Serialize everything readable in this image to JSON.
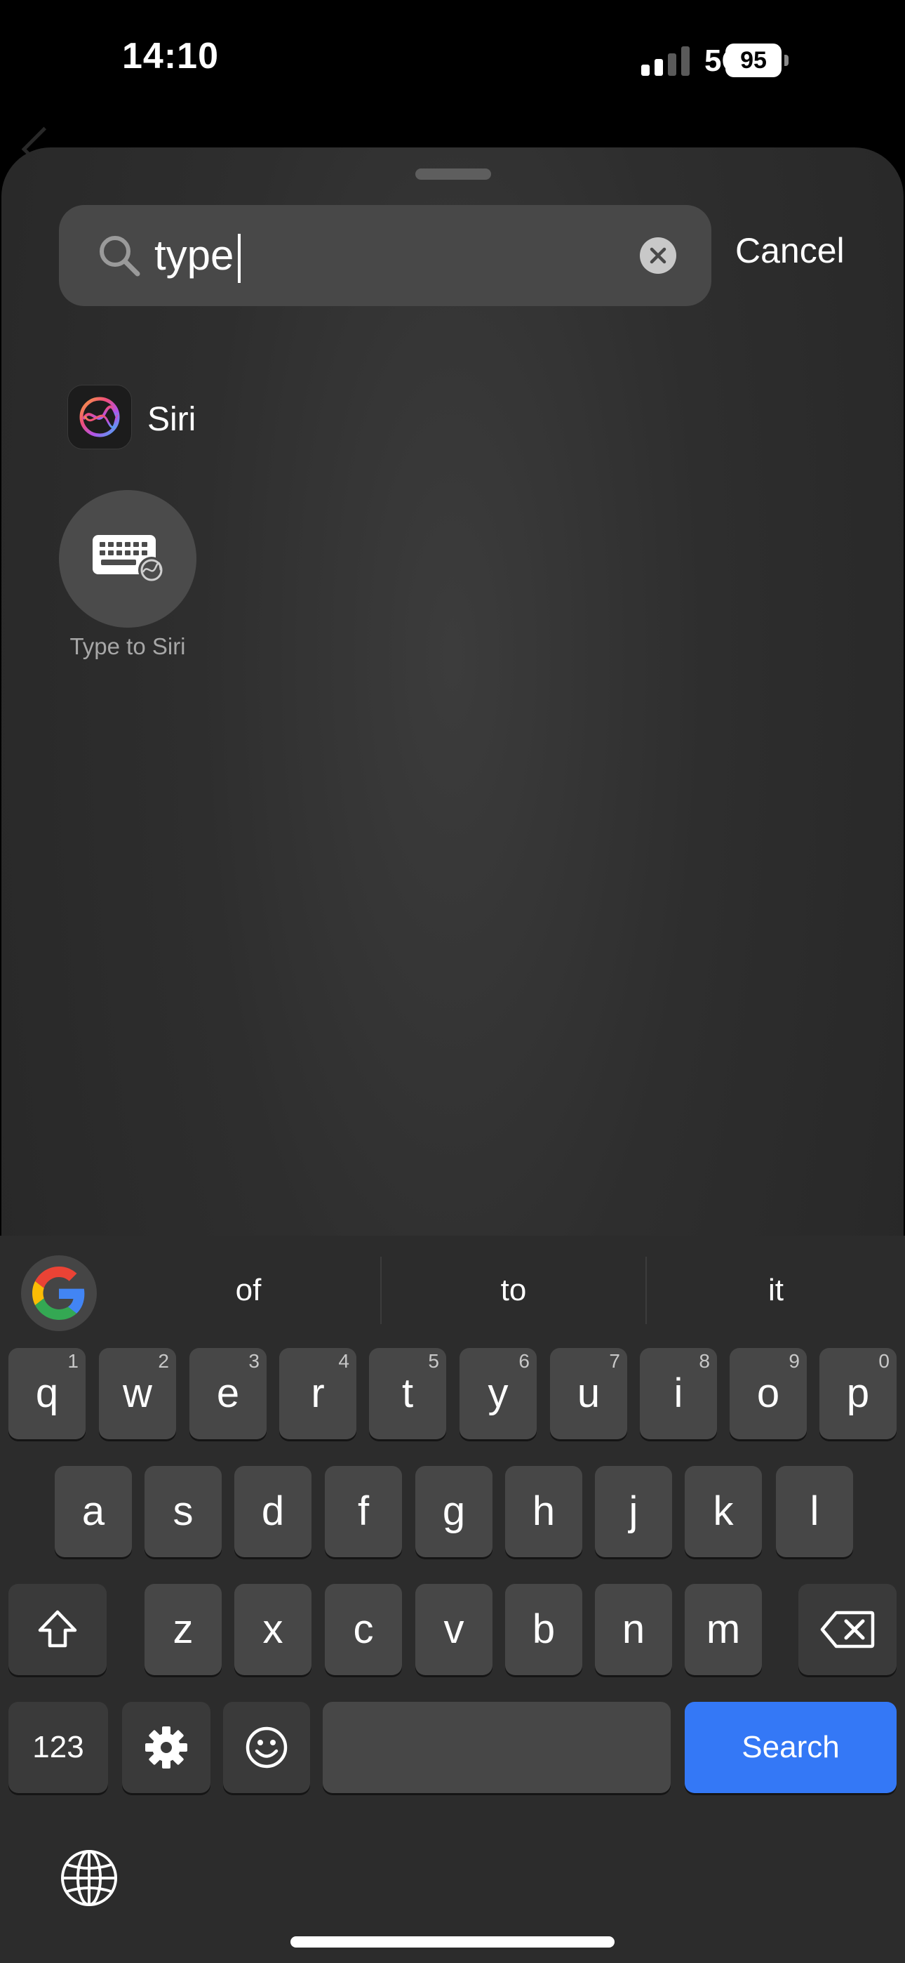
{
  "status_bar": {
    "time": "14:10",
    "network": "5G",
    "battery": "95"
  },
  "search": {
    "query": "type",
    "cancel_label": "Cancel"
  },
  "results": {
    "app": {
      "label": "Siri",
      "icon": "siri-icon"
    },
    "shortcut": {
      "label": "Type to Siri",
      "icon": "keyboard-siri-icon"
    }
  },
  "keyboard": {
    "suggestions": [
      "of",
      "to",
      "it"
    ],
    "row1": [
      {
        "label": "q",
        "hint": "1"
      },
      {
        "label": "w",
        "hint": "2"
      },
      {
        "label": "e",
        "hint": "3"
      },
      {
        "label": "r",
        "hint": "4"
      },
      {
        "label": "t",
        "hint": "5"
      },
      {
        "label": "y",
        "hint": "6"
      },
      {
        "label": "u",
        "hint": "7"
      },
      {
        "label": "i",
        "hint": "8"
      },
      {
        "label": "o",
        "hint": "9"
      },
      {
        "label": "p",
        "hint": "0"
      }
    ],
    "row2": [
      "a",
      "s",
      "d",
      "f",
      "g",
      "h",
      "j",
      "k",
      "l"
    ],
    "row3": [
      "z",
      "x",
      "c",
      "v",
      "b",
      "n",
      "m"
    ],
    "numbers_label": "123",
    "search_label": "Search",
    "accent_color": "#3478f6"
  }
}
